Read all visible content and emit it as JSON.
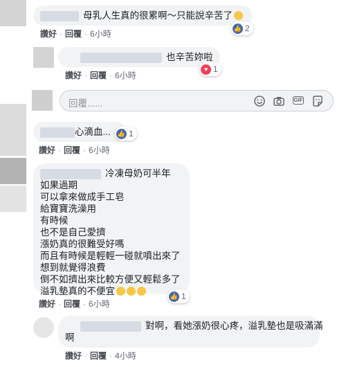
{
  "actions": {
    "like": "讚好",
    "reply": "回覆",
    "sep": "·"
  },
  "comments": [
    {
      "text": "母乳人生真的很累啊～只能說辛苦了",
      "time": "6小時",
      "reaction_count": "2"
    },
    {
      "text": "也辛苦妳啦",
      "time": "6小時",
      "reaction_count": "1"
    },
    {
      "text": "心滴血...",
      "time": "6小時",
      "reaction_count": "1"
    },
    {
      "title": "冷凍母奶可半年",
      "lines": [
        "如果過期",
        "可以拿來做成手工皂",
        "給寶寶洗澡用",
        "有時候",
        "也不是自己愛擠",
        "漲奶真的很難受好嗎",
        "而且有時候是輕輕一碰就噴出來了",
        "想到就覺得浪費",
        "倒不如擠出來比較方便又輕鬆多了",
        "溢乳墊真的不便宜"
      ],
      "time": "6小時",
      "reaction_count": "1"
    },
    {
      "text_line1": "對啊，看她漲奶很心疼，溢乳墊也是吸滿滿",
      "text_line2": "啊",
      "time": "4小時"
    }
  ],
  "reply_box": {
    "placeholder": "回覆......",
    "gif_label": "GIF"
  },
  "icons": [
    "smile-icon",
    "camera-icon",
    "gif-icon",
    "sticker-icon",
    "like-icon",
    "love-icon",
    "emoji-icon"
  ]
}
